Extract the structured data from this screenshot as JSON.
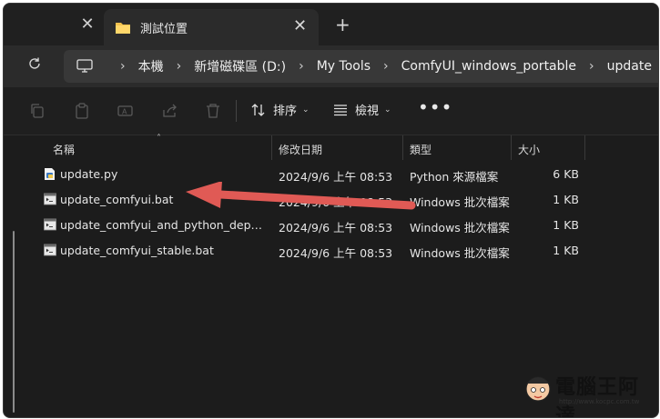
{
  "tabs": {
    "active_title": "測試位置",
    "new_tab_glyph": "+",
    "close_glyph": "✕"
  },
  "addressbar": {
    "breadcrumbs": [
      "本機",
      "新增磁碟區 (D:)",
      "My Tools",
      "ComfyUI_windows_portable",
      "update"
    ]
  },
  "toolbar": {
    "sort_label": "排序",
    "view_label": "檢視",
    "more_glyph": "•••"
  },
  "columns": {
    "name": "名稱",
    "date": "修改日期",
    "type": "類型",
    "size": "大小"
  },
  "files": [
    {
      "name": "update.py",
      "date": "2024/9/6 上午 08:53",
      "type": "Python 來源檔案",
      "size": "6 KB",
      "icon": "python-file-icon"
    },
    {
      "name": "update_comfyui.bat",
      "date": "2024/9/6 上午 08:53",
      "type": "Windows 批次檔案",
      "size": "1 KB",
      "icon": "batch-file-icon"
    },
    {
      "name": "update_comfyui_and_python_depend...",
      "date": "2024/9/6 上午 08:53",
      "type": "Windows 批次檔案",
      "size": "1 KB",
      "icon": "batch-file-icon"
    },
    {
      "name": "update_comfyui_stable.bat",
      "date": "2024/9/6 上午 08:53",
      "type": "Windows 批次檔案",
      "size": "1 KB",
      "icon": "batch-file-icon"
    }
  ],
  "annotation": {
    "arrow_color": "#e05a55"
  },
  "watermark": {
    "text": "電腦王阿達",
    "url": "http://www.kocpc.com.tw"
  },
  "colors": {
    "background": "#1c1c1c",
    "tab_active": "#2b2b2b",
    "address_bar": "#383838",
    "folder": "#f2c14e"
  }
}
